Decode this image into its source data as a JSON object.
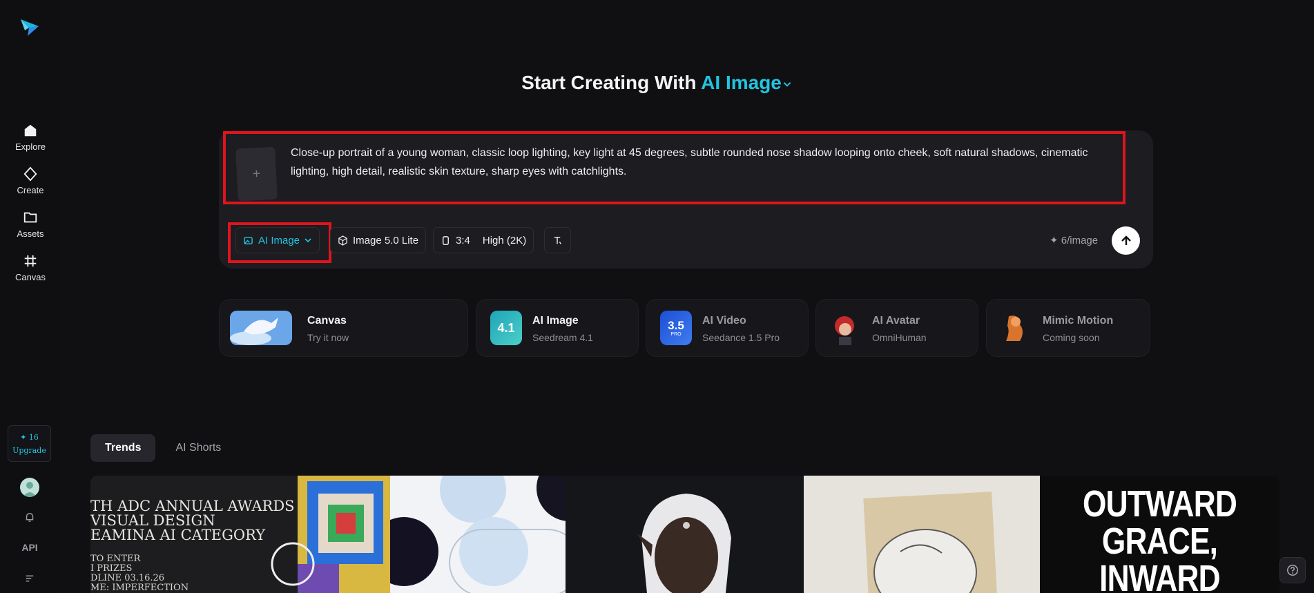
{
  "nav": {
    "items": [
      {
        "label": "Explore",
        "icon": "home-icon"
      },
      {
        "label": "Create",
        "icon": "diamond-icon"
      },
      {
        "label": "Assets",
        "icon": "folder-icon"
      },
      {
        "label": "Canvas",
        "icon": "frame-icon"
      }
    ],
    "credits": "✦ 16",
    "upgrade": "Upgrade",
    "api_label": "API"
  },
  "hero": {
    "title_prefix": "Start Creating With",
    "title_accent": "AI Image"
  },
  "composer": {
    "prompt": "Close-up portrait of a young woman, classic loop lighting, key light at 45 degrees, subtle rounded nose shadow looping onto cheek, soft natural shadows, cinematic lighting, high detail, realistic skin texture, sharp eyes with catchlights.",
    "upload_symbol": "+",
    "mode": "AI Image",
    "model": "Image 5.0 Lite",
    "ratio": "3:4",
    "quality": "High (2K)",
    "cost": "6/image",
    "cost_symbol": "✦"
  },
  "tools": [
    {
      "title": "Canvas",
      "subtitle": "Try it now"
    },
    {
      "title": "AI Image",
      "subtitle": "Seedream 4.1",
      "badge": "4.1"
    },
    {
      "title": "AI Video",
      "subtitle": "Seedance 1.5 Pro",
      "badge": "3.5",
      "badge_sub": "PRO"
    },
    {
      "title": "AI Avatar",
      "subtitle": "OmniHuman"
    },
    {
      "title": "Mimic Motion",
      "subtitle": "Coming soon"
    }
  ],
  "tabs": [
    {
      "label": "Trends",
      "active": true
    },
    {
      "label": "AI Shorts",
      "active": false
    }
  ],
  "gallery": {
    "tile1": {
      "lines": [
        "TH ADC ANNUAL AWARDS",
        "VISUAL DESIGN",
        "EAMINA AI CATEGORY"
      ],
      "small_lines": [
        "TO ENTER",
        "I PRIZES",
        "DLINE 03.16.26",
        "ME: IMPERFECTION"
      ]
    },
    "tile5": {
      "lines": [
        "OUTWARD",
        "GRACE,",
        "INWARD"
      ]
    }
  },
  "colors": {
    "accent": "#22c5e0",
    "highlight": "#e0141c",
    "background": "#101013"
  }
}
